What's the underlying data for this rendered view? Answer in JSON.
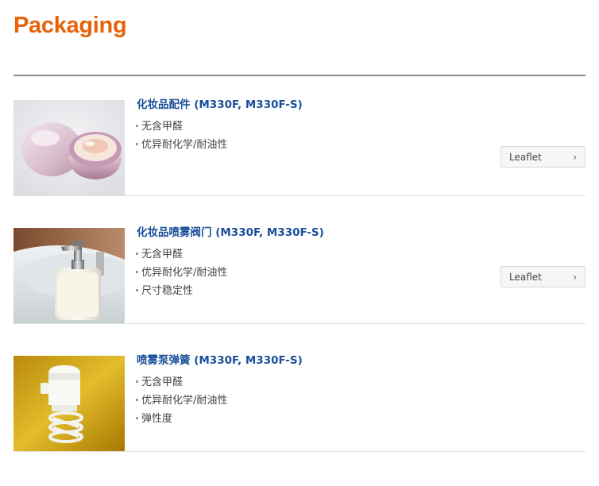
{
  "page": {
    "title": "Packaging"
  },
  "products": [
    {
      "name": "化妆品配件 (M330F, M330F-S)",
      "features": [
        "无含甲醛",
        "优异耐化学/耐油性"
      ],
      "leaflet_label": "Leaflet",
      "image_icon": "cosmetic-jar-image"
    },
    {
      "name": "化妆品喷雾阀门 (M330F, M330F-S)",
      "features": [
        "无含甲醛",
        "优异耐化学/耐油性",
        "尺寸稳定性"
      ],
      "leaflet_label": "Leaflet",
      "image_icon": "pump-dispenser-image"
    },
    {
      "name": "喷雾泵弹簧 (M330F, M330F-S)",
      "features": [
        "无含甲醛",
        "优异耐化学/耐油性",
        "弹性度"
      ],
      "image_icon": "spray-pump-spring-image"
    }
  ],
  "colors": {
    "title": "#e8620a",
    "product_name": "#1a4f99",
    "rule": "#8a8a8a"
  }
}
